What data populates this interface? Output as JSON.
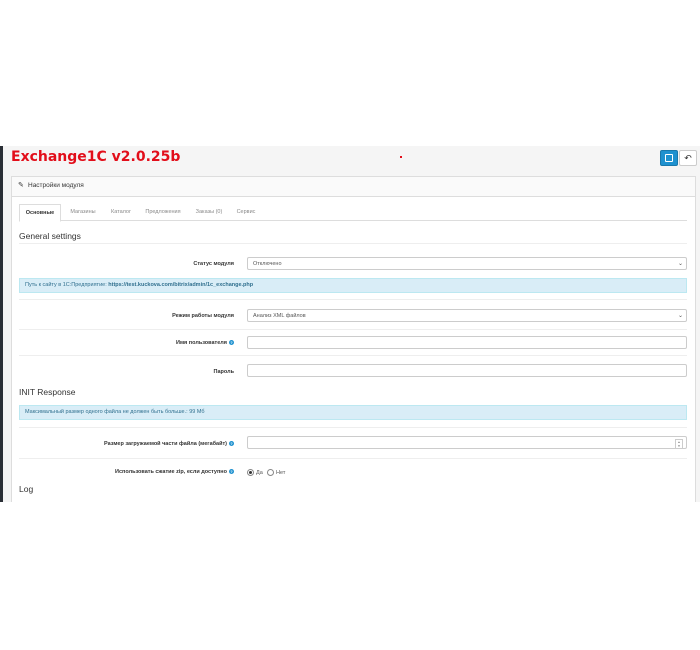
{
  "header": {
    "title": "Exchange1C v2.0.25b"
  },
  "toolbar": {
    "save_icon": "save-icon",
    "back_icon": "reply-icon"
  },
  "panel": {
    "heading": "Настройки модуля",
    "heading_icon": "pencil-icon"
  },
  "tabs": [
    {
      "label": "Основные",
      "active": true
    },
    {
      "label": "Магазины",
      "active": false
    },
    {
      "label": "Каталог",
      "active": false
    },
    {
      "label": "Предложения",
      "active": false
    },
    {
      "label": "Заказы (0)",
      "active": false
    },
    {
      "label": "Сервис",
      "active": false
    }
  ],
  "general": {
    "section_title": "General settings",
    "status_label": "Статус модуля",
    "status_value": "Отключено",
    "path_info_prefix": "Путь к сайту в 1С:Предприятие:",
    "path_info_url": "https://test.kuckova.com/bitrix/admin/1c_exchange.php",
    "mode_label": "Режим работы модуля",
    "mode_value": "Анализ XML файлов",
    "username_label": "Имя пользователя",
    "username_value": "",
    "password_label": "Пароль",
    "password_value": ""
  },
  "init": {
    "section_title": "INIT Response",
    "max_size_info": "Максимальный размер одного файла не должен быть больше.: 99 Мб",
    "chunk_label": "Размер загружаемой части файла (мегабайт)",
    "chunk_value": "",
    "zip_label": "Использовать сжатие zip, если доступно",
    "zip_yes": "Да",
    "zip_no": "Нет",
    "zip_selected": "yes"
  },
  "log": {
    "section_title": "Log"
  },
  "colors": {
    "title_red": "#e20e1a",
    "primary": "#1e91cf",
    "info_bg": "#d9edf7"
  }
}
